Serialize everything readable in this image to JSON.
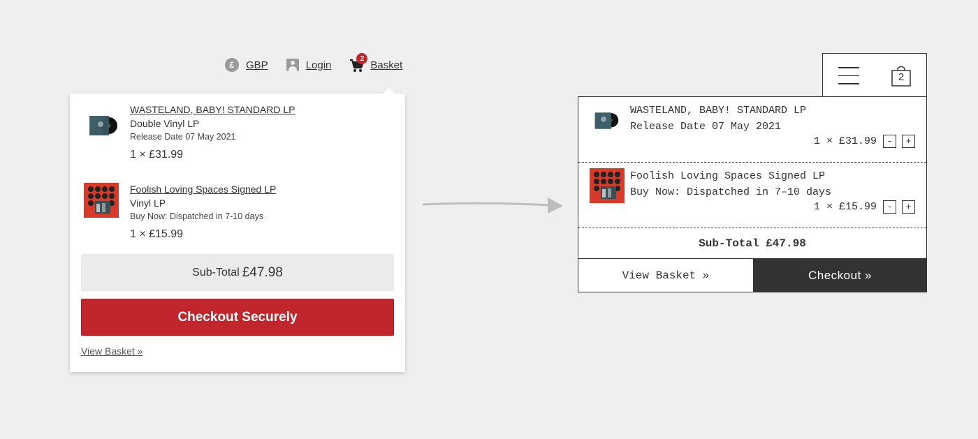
{
  "nav": {
    "currency_icon": "£",
    "currency": "GBP",
    "login": "Login",
    "basket": "Basket",
    "basket_count": "2"
  },
  "dropdown": {
    "items": [
      {
        "title": "WASTELAND, BABY! STANDARD LP",
        "format": "Double Vinyl LP",
        "release": "Release Date 07 May 2021",
        "price": "1 × £31.99"
      },
      {
        "title": "Foolish Loving Spaces Signed LP",
        "format": "Vinyl LP",
        "release": "Buy Now: Dispatched in 7-10 days",
        "price": "1 × £15.99"
      }
    ],
    "subtotal_label": "Sub-Total",
    "subtotal_amount": "£47.98",
    "checkout": "Checkout Securely",
    "view_basket": "View Basket »"
  },
  "redesign": {
    "bag_count": "2",
    "items": [
      {
        "title": "WASTELAND, BABY! STANDARD LP",
        "release": "Release Date 07 May 2021",
        "price": "1 × £31.99",
        "minus": "-",
        "plus": "+"
      },
      {
        "title": "Foolish Loving Spaces Signed LP",
        "release": "Buy Now: Dispatched in 7–10 days",
        "price": "1 × £15.99",
        "minus": "-",
        "plus": "+"
      }
    ],
    "subtotal": "Sub-Total £47.98",
    "view_basket": "View Basket »",
    "checkout": "Checkout »"
  },
  "colors": {
    "accent_red": "#c0262c",
    "dark": "#333333",
    "background": "#efefef"
  }
}
